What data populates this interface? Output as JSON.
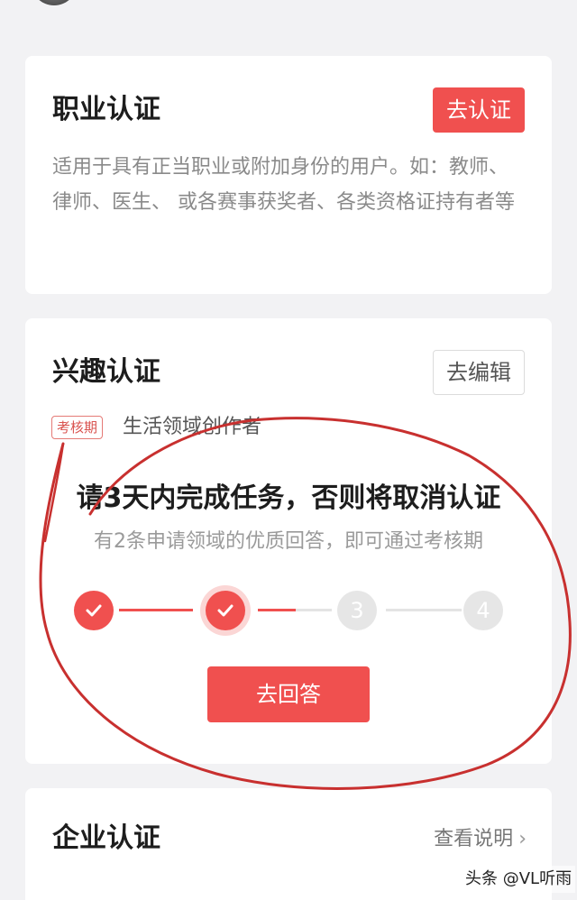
{
  "professional_cert": {
    "title": "职业认证",
    "button_label": "去认证",
    "description": "适用于具有正当职业或附加身份的用户。如：教师、律师、医生、 或各赛事获奖者、各类资格证持有者等"
  },
  "interest_cert": {
    "title": "兴趣认证",
    "edit_label": "去编辑",
    "tag": "考核期",
    "tag_text": "生活领域创作者",
    "task_title": "请3天内完成任务，否则将取消认证",
    "task_subtitle": "有2条申请领域的优质回答，即可通过考核期",
    "steps": [
      {
        "state": "done",
        "label": ""
      },
      {
        "state": "current",
        "label": ""
      },
      {
        "state": "todo",
        "label": "3"
      },
      {
        "state": "todo",
        "label": "4"
      }
    ],
    "progress": 0.5,
    "answer_button": "去回答"
  },
  "enterprise_cert": {
    "title": "企业认证",
    "link_label": "查看说明",
    "chevron": "chevron-right-icon"
  },
  "watermark": "头条 @VL听雨",
  "colors": {
    "accent": "#f0504f",
    "annotation": "#c8302f"
  }
}
